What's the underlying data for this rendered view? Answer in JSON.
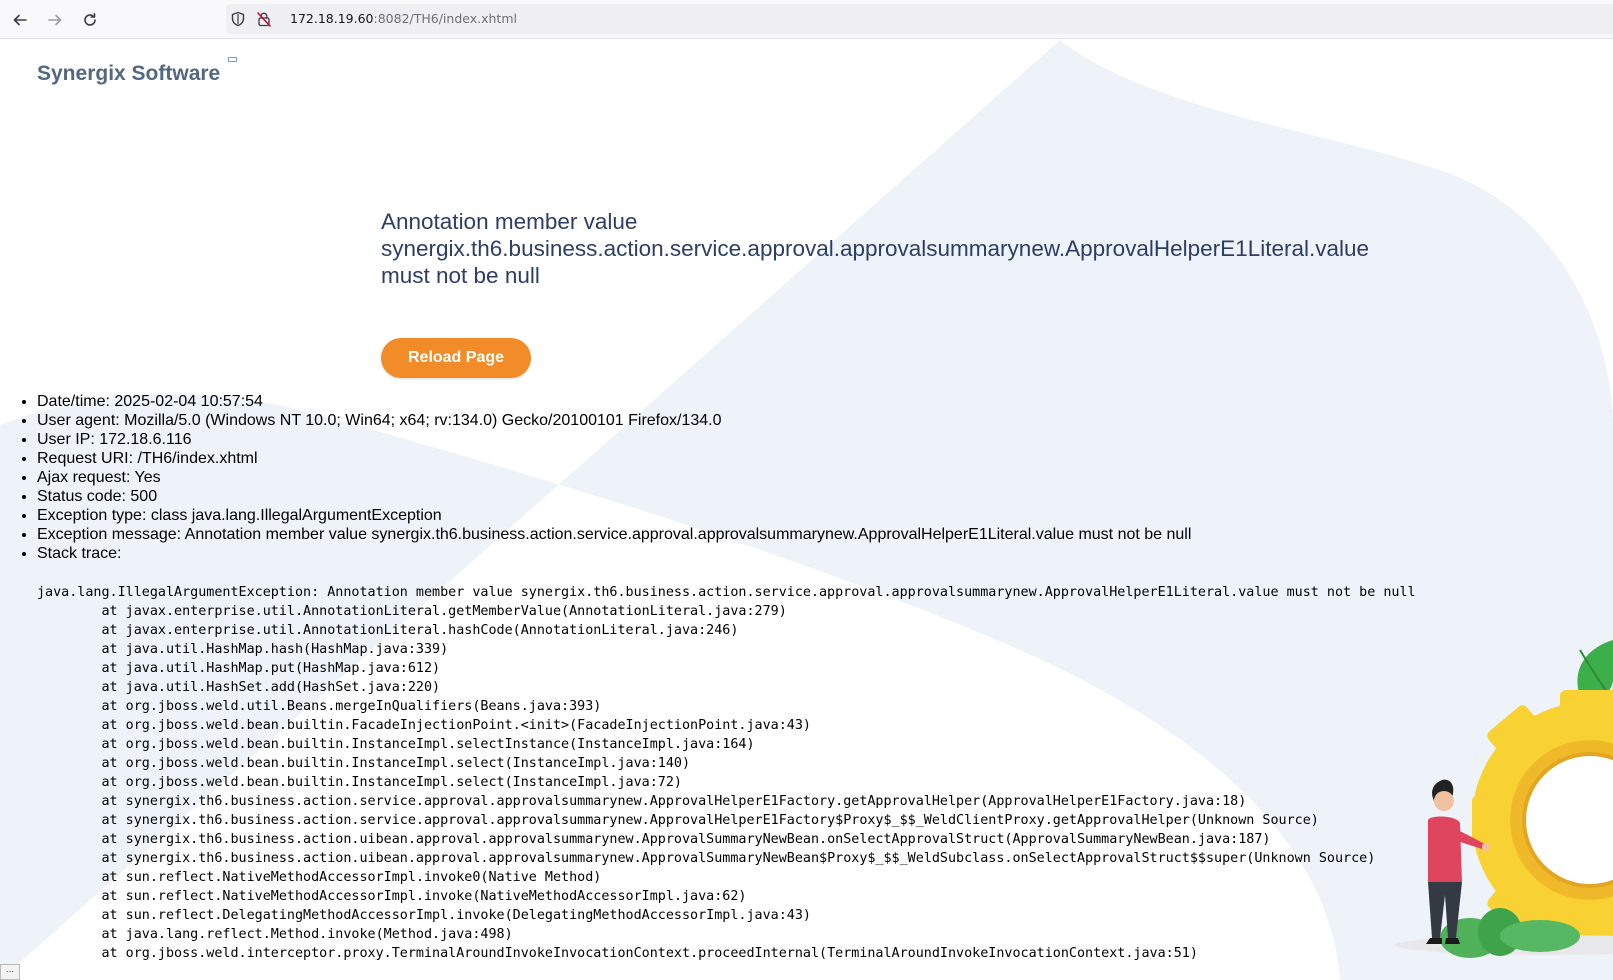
{
  "browser": {
    "url_host": "172.18.19.60",
    "url_rest": ":8082/TH6/index.xhtml"
  },
  "brand": {
    "name": "Synergix Software"
  },
  "error": {
    "title": "Annotation member value synergix.th6.business.action.service.approval.approvalsummarynew.ApprovalHelperE1Literal.value must not be null",
    "reload_label": "Reload Page"
  },
  "details": [
    {
      "label": "Date/time:",
      "value": "2025-02-04 10:57:54"
    },
    {
      "label": "User agent:",
      "value": "Mozilla/5.0 (Windows NT 10.0; Win64; x64; rv:134.0) Gecko/20100101 Firefox/134.0"
    },
    {
      "label": "User IP:",
      "value": "172.18.6.116"
    },
    {
      "label": "Request URI:",
      "value": "/TH6/index.xhtml"
    },
    {
      "label": "Ajax request:",
      "value": "Yes"
    },
    {
      "label": "Status code:",
      "value": "500"
    },
    {
      "label": "Exception type:",
      "value": "class java.lang.IllegalArgumentException"
    },
    {
      "label": "Exception message:",
      "value": "Annotation member value synergix.th6.business.action.service.approval.approvalsummarynew.ApprovalHelperE1Literal.value must not be null"
    },
    {
      "label": "Stack trace:",
      "value": ""
    }
  ],
  "stack_trace": "java.lang.IllegalArgumentException: Annotation member value synergix.th6.business.action.service.approval.approvalsummarynew.ApprovalHelperE1Literal.value must not be null\n\tat javax.enterprise.util.AnnotationLiteral.getMemberValue(AnnotationLiteral.java:279)\n\tat javax.enterprise.util.AnnotationLiteral.hashCode(AnnotationLiteral.java:246)\n\tat java.util.HashMap.hash(HashMap.java:339)\n\tat java.util.HashMap.put(HashMap.java:612)\n\tat java.util.HashSet.add(HashSet.java:220)\n\tat org.jboss.weld.util.Beans.mergeInQualifiers(Beans.java:393)\n\tat org.jboss.weld.bean.builtin.FacadeInjectionPoint.<init>(FacadeInjectionPoint.java:43)\n\tat org.jboss.weld.bean.builtin.InstanceImpl.selectInstance(InstanceImpl.java:164)\n\tat org.jboss.weld.bean.builtin.InstanceImpl.select(InstanceImpl.java:140)\n\tat org.jboss.weld.bean.builtin.InstanceImpl.select(InstanceImpl.java:72)\n\tat synergix.th6.business.action.service.approval.approvalsummarynew.ApprovalHelperE1Factory.getApprovalHelper(ApprovalHelperE1Factory.java:18)\n\tat synergix.th6.business.action.service.approval.approvalsummarynew.ApprovalHelperE1Factory$Proxy$_$$_WeldClientProxy.getApprovalHelper(Unknown Source)\n\tat synergix.th6.business.action.uibean.approval.approvalsummarynew.ApprovalSummaryNewBean.onSelectApprovalStruct(ApprovalSummaryNewBean.java:187)\n\tat synergix.th6.business.action.uibean.approval.approvalsummarynew.ApprovalSummaryNewBean$Proxy$_$$_WeldSubclass.onSelectApprovalStruct$$super(Unknown Source)\n\tat sun.reflect.NativeMethodAccessorImpl.invoke0(Native Method)\n\tat sun.reflect.NativeMethodAccessorImpl.invoke(NativeMethodAccessorImpl.java:62)\n\tat sun.reflect.DelegatingMethodAccessorImpl.invoke(DelegatingMethodAccessorImpl.java:43)\n\tat java.lang.reflect.Method.invoke(Method.java:498)\n\tat org.jboss.weld.interceptor.proxy.TerminalAroundInvokeInvocationContext.proceedInternal(TerminalAroundInvokeInvocationContext.java:51)",
  "corner_widget": "...",
  "colors": {
    "accent": "#f28c28",
    "title": "#2c3e66",
    "brand": "#536780",
    "background_shape": "#eef3f9"
  },
  "icons": [
    "back-arrow-icon",
    "forward-arrow-icon",
    "reload-icon",
    "shield-icon",
    "insecure-lock-icon"
  ]
}
